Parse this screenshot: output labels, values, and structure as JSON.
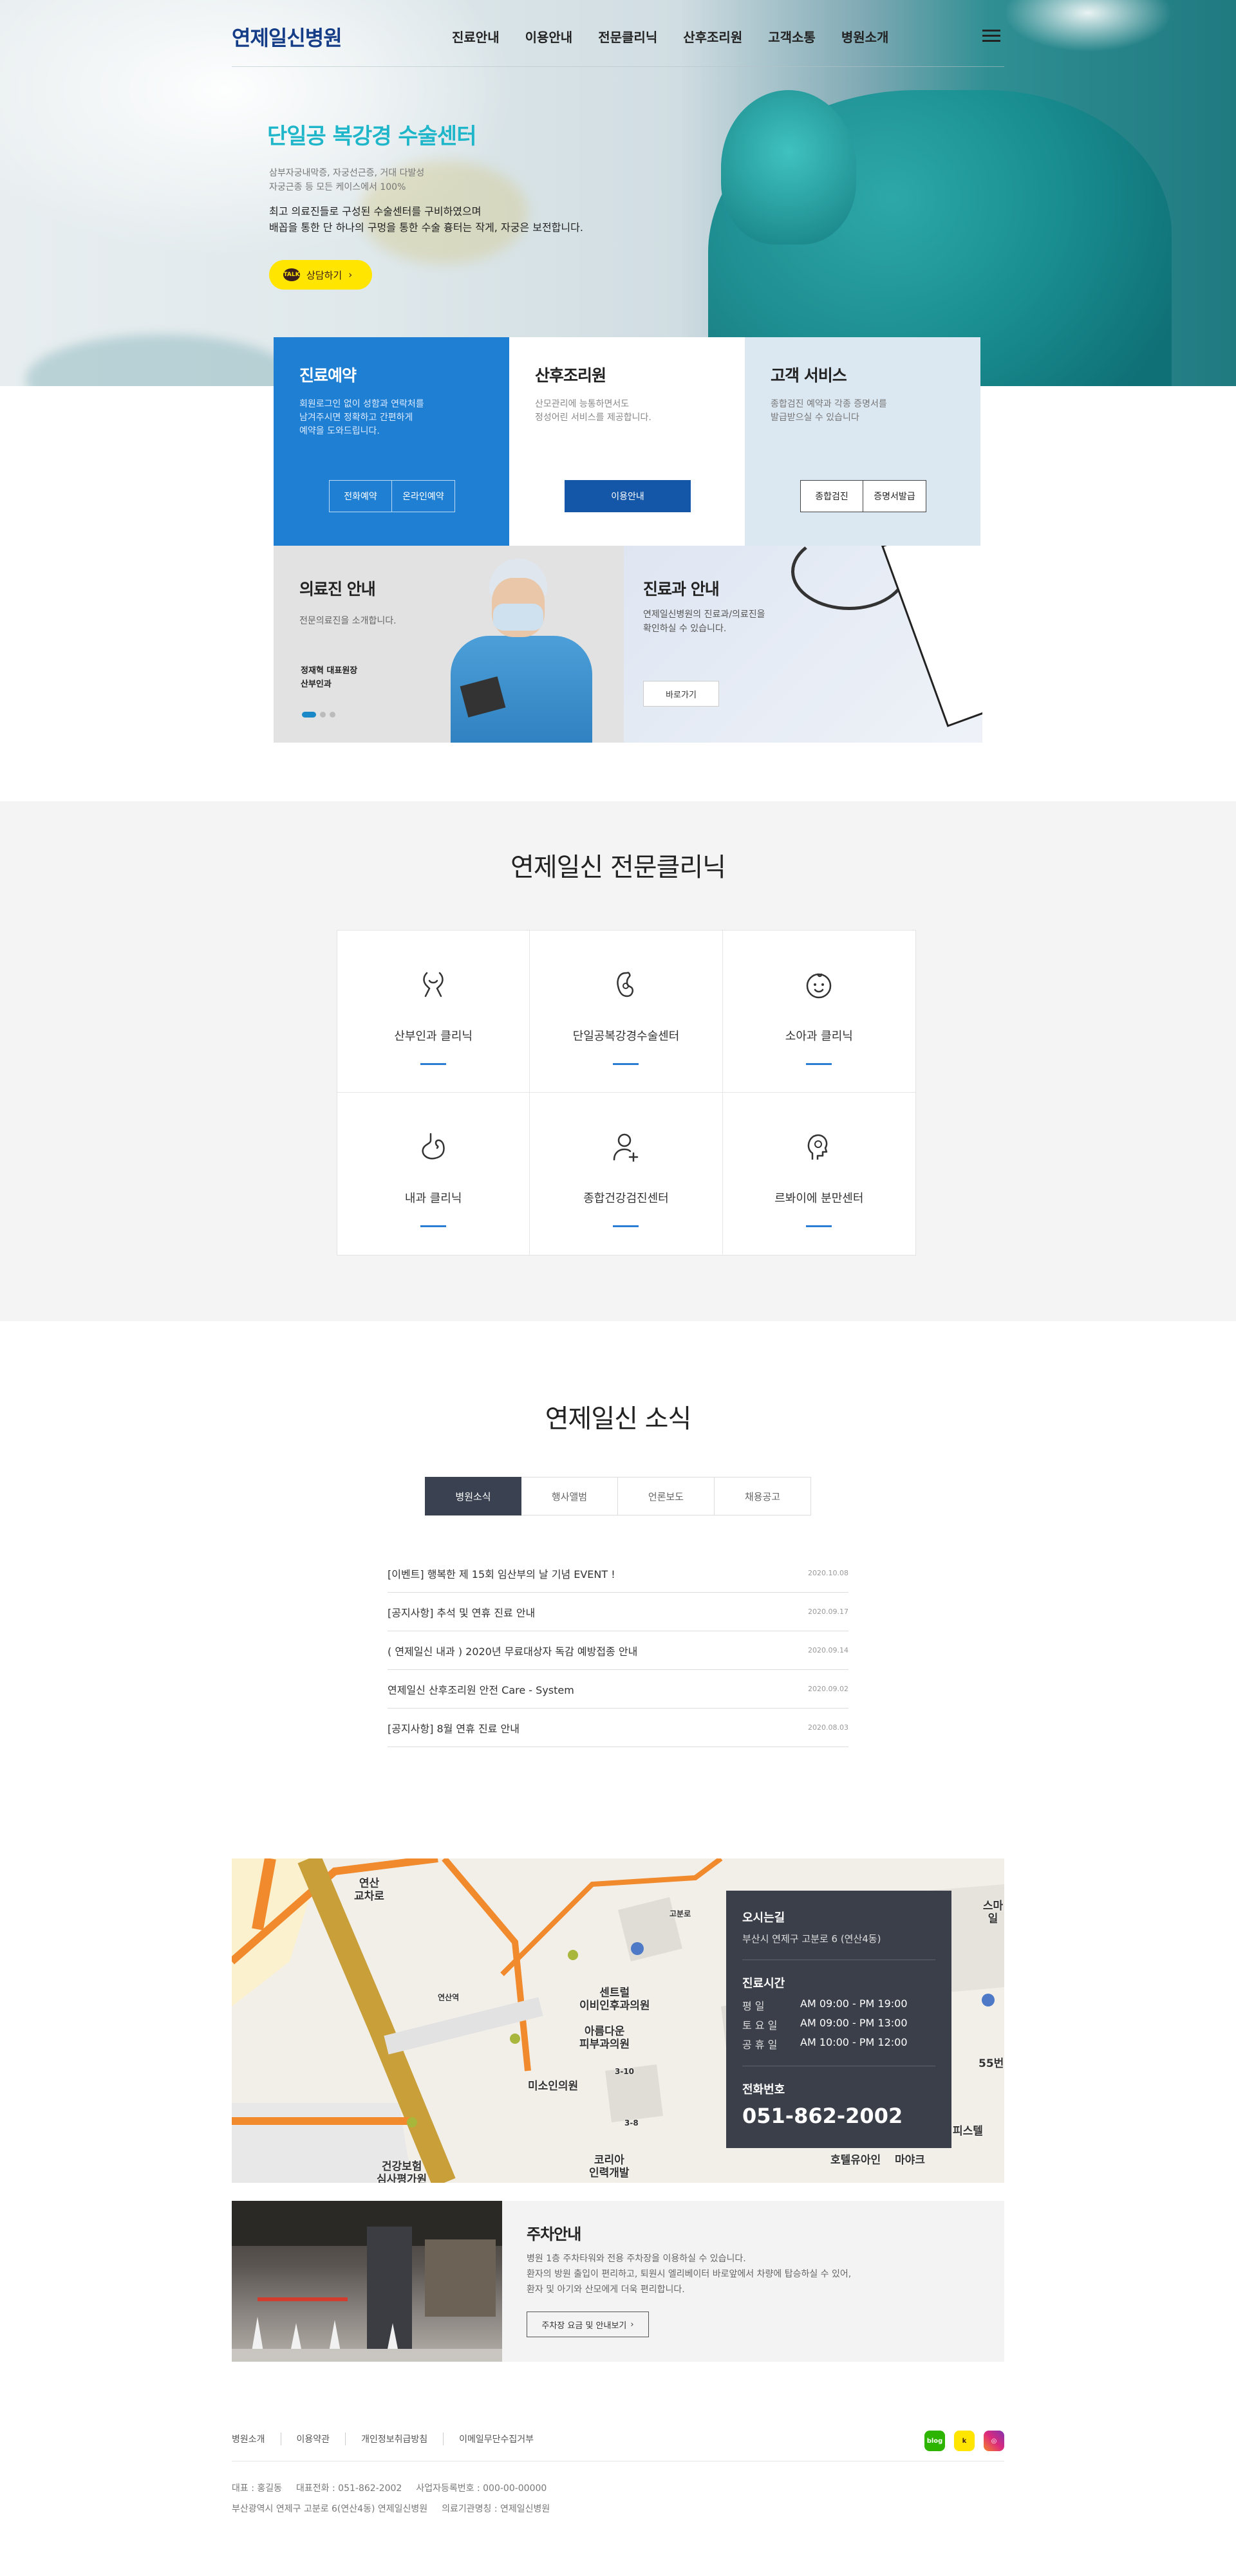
{
  "header": {
    "logo": "연제일신병원",
    "nav": [
      "진료안내",
      "이용안내",
      "전문클리닉",
      "산후조리원",
      "고객소통",
      "병원소개"
    ]
  },
  "hero": {
    "title": "단일공 복강경 수술센터",
    "desc1": "삼부자궁내막증, 자궁선근증, 거대 다발성\n자궁근종 등 모든 케이스에서 100%",
    "desc2": "최고 의료진들로 구성된 수술센터를 구비하였으며\n배꼽을 통한 단 하나의 구멍을 통한 수술 흉터는 작게, 자궁은 보전합니다.",
    "talk_btn": "상담하기",
    "talk_icon": "TALK"
  },
  "services": [
    {
      "title": "진료예약",
      "desc": "회원로그인 없이 성함과 연락처를\n남겨주시면 정확하고 간편하게\n예약을 도와드립니다.",
      "buttons": [
        "전화예약",
        "온라인예약"
      ]
    },
    {
      "title": "산후조리원",
      "desc": "산모관리에 능통하면서도\n정성어린 서비스를 제공합니다.",
      "buttons": [
        "이용안내"
      ]
    },
    {
      "title": "고객 서비스",
      "desc": "종합검진 예약과 각종 증명서를\n발급받으실 수 있습니다",
      "buttons": [
        "종합검진",
        "증명서발급"
      ]
    }
  ],
  "doctor_card": {
    "title": "의료진 안내",
    "desc": "전문의료진을 소개합니다.",
    "name": "정재혁 대표원장\n산부인과"
  },
  "dept_card": {
    "title": "진료과 안내",
    "desc": "연제일신병원의 진료과/의료진을\n확인하실 수 있습니다.",
    "button": "바로가기"
  },
  "clinic": {
    "title": "연제일신 전문클리닉",
    "items": [
      {
        "label": "산부인과 클리닉",
        "icon": "uterus-icon"
      },
      {
        "label": "단일공복강경수술센터",
        "icon": "kidney-icon"
      },
      {
        "label": "소아과 클리닉",
        "icon": "baby-face-icon"
      },
      {
        "label": "내과 클리닉",
        "icon": "stomach-icon"
      },
      {
        "label": "종합건강검진센터",
        "icon": "person-plus-icon"
      },
      {
        "label": "르봐이에 분만센터",
        "icon": "head-icon"
      }
    ]
  },
  "news": {
    "title": "연제일신 소식",
    "tabs": [
      "병원소식",
      "행사앨범",
      "언론보도",
      "채용공고"
    ],
    "items": [
      {
        "title": "[이벤트] 행복한 제 15회 임산부의 날 기념 EVENT !",
        "date": "2020.10.08"
      },
      {
        "title": "[공지사항] 추석 및 연휴 진료 안내",
        "date": "2020.09.17"
      },
      {
        "title": "( 연제일신 내과 ) 2020년 무료대상자 독감 예방접종 안내",
        "date": "2020.09.14"
      },
      {
        "title": "연제일신 산후조리원 안전 Care - System",
        "date": "2020.09.02"
      },
      {
        "title": "[공지사항] 8월 연휴 진료 안내",
        "date": "2020.08.03"
      }
    ]
  },
  "location": {
    "label_addr": "오시는길",
    "addr": "부산시 연제구 고분로 6 (연산4동)",
    "label_hours": "진료시간",
    "hours": [
      {
        "day": "평    일",
        "time": "AM 09:00 - PM 19:00"
      },
      {
        "day": "토 요 일",
        "time": "AM 09:00 - PM 13:00"
      },
      {
        "day": "공 휴 일",
        "time": "AM 10:00 - PM 12:00"
      }
    ],
    "label_tel": "전화번호",
    "tel": "051-862-2002",
    "map_labels": [
      "연산\n교차로",
      "센트럴\n이비인후과의원",
      "아름다운\n피부과의원",
      "미소인의원",
      "코리아\n인력개발",
      "건강보험\n심사평가원",
      "호텔유아인",
      "마야크",
      "피스텔",
      "55번",
      "스마일",
      "고분로",
      "연산역",
      "3-10",
      "3-8"
    ]
  },
  "parking": {
    "title": "주차안내",
    "desc": "병원 1층 주차타워와 전용 주차장을 이용하실 수 있습니다.\n환자의 방원 출입이 편리하고, 퇴원시 엘리베이터 바로앞에서 차량에 탑승하실 수 있어,\n환자 및 아기와 산모에게 더욱 편리합니다.",
    "button": "주차장 요금 및 안내보기"
  },
  "footer": {
    "links": [
      "병원소개",
      "이용약관",
      "개인정보취급방침",
      "이메일무단수집거부"
    ],
    "info1": [
      "대표 : 홍길동",
      "대표전화 : 051-862-2002",
      "사업자등록번호 : 000-00-00000"
    ],
    "info2": [
      "부산광역시 연제구 고분로 6(연산4동) 연제일신병원",
      "의료기관명칭 : 연제일신병원"
    ],
    "sns": [
      {
        "name": "blog-icon",
        "text": "blog",
        "color": "#2db400"
      },
      {
        "name": "kakao-icon",
        "text": "k",
        "color": "#ffe500"
      },
      {
        "name": "instagram-icon",
        "text": "",
        "color": "#d6249f"
      }
    ]
  }
}
